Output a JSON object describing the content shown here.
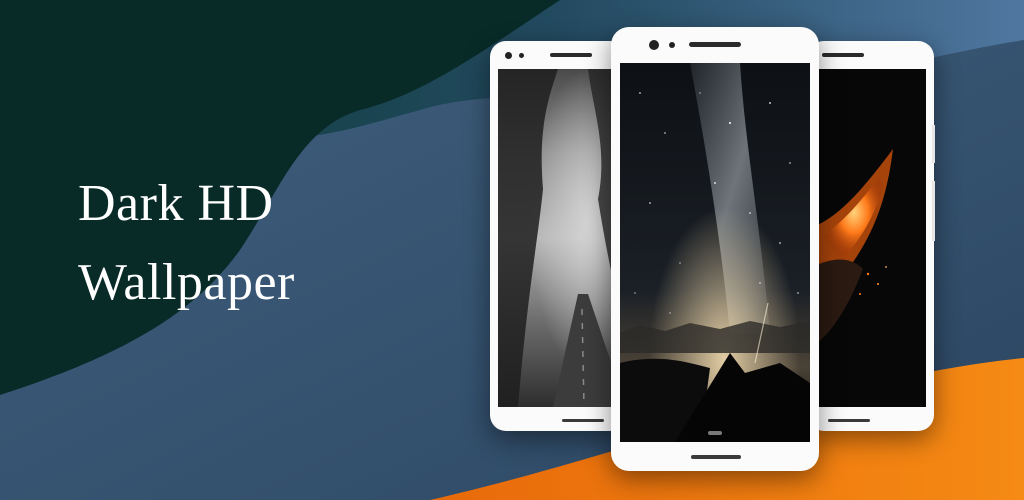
{
  "banner": {
    "title_line1": "Dark HD",
    "title_line2": "Wallpaper"
  },
  "colors": {
    "dark_green": "#082b28",
    "slate_blue": "#3a5878",
    "orange": "#f07c10",
    "phone_frame": "#fbfbfb"
  },
  "phones": [
    {
      "name": "left",
      "wallpaper": "foggy-forest-road"
    },
    {
      "name": "center",
      "wallpaper": "milky-way-night-sky"
    },
    {
      "name": "right",
      "wallpaper": "burning-ember"
    }
  ]
}
